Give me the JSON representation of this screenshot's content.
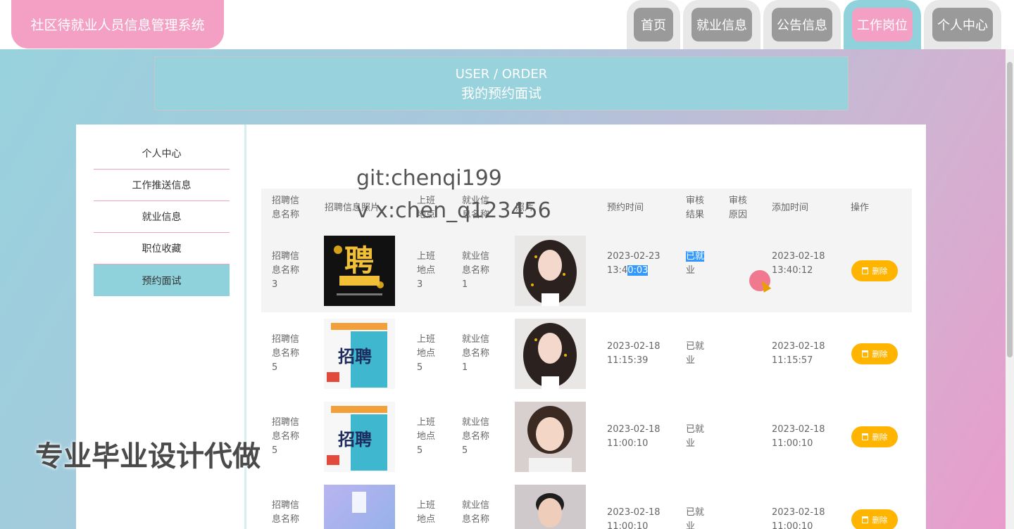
{
  "app": {
    "title": "社区待就业人员信息管理系统"
  },
  "nav": {
    "items": [
      "首页",
      "就业信息",
      "公告信息",
      "工作岗位",
      "个人中心"
    ],
    "active": "工作岗位"
  },
  "banner": {
    "en": "USER / ORDER",
    "zh": "我的预约面试"
  },
  "sidebar": {
    "items": [
      "个人中心",
      "工作推送信息",
      "就业信息",
      "职位收藏",
      "预约面试"
    ],
    "active": "预约面试"
  },
  "table": {
    "headers": [
      "招聘信\n息名称",
      "招聘信息照片",
      "上班\n地点",
      "就业信\n息名称",
      "照片",
      "预约时间",
      "审核\n结果",
      "审核\n原因",
      "添加时间",
      "操作"
    ],
    "rows": [
      {
        "name": "招聘信\n息名称\n3",
        "place": "上班\n地点\n3",
        "job": "就业信\n息名称\n1",
        "appt_date": "2023-02-23",
        "appt_time_a": "13:4",
        "appt_time_b": "0:03",
        "result_a": "已就",
        "result_b": "业",
        "reason": "",
        "added": "2023-02-18\n13:40:12",
        "action": "删除"
      },
      {
        "name": "招聘信\n息名称\n5",
        "place": "上班\n地点\n5",
        "job": "就业信\n息名称\n1",
        "appt": "2023-02-18\n11:15:39",
        "result": "已就\n业",
        "reason": "",
        "added": "2023-02-18\n11:15:57",
        "action": "删除"
      },
      {
        "name": "招聘信\n息名称\n5",
        "place": "上班\n地点\n5",
        "job": "就业信\n息名称\n5",
        "appt": "2023-02-18\n11:00:10",
        "result": "已就\n业",
        "reason": "",
        "added": "2023-02-18\n11:00:10",
        "action": "删除"
      },
      {
        "name": "招聘信\n息名称",
        "place": "上班\n地点",
        "job": "就业信\n息名称",
        "appt": "2023-02-18\n11:00:10",
        "result": "已就\n业",
        "reason": "",
        "added": "2023-02-18\n11:00:10",
        "action": "删除"
      }
    ]
  },
  "watermarks": {
    "git": "git:chenqi199",
    "vx": "v x:chen_q123456",
    "promo": "专业毕业设计代做"
  },
  "images": {
    "poster1_text": "聘",
    "poster2_text": "招聘"
  },
  "colors": {
    "pink": "#f3a0c4",
    "teal": "#8fd2dc",
    "delete": "#ffb400"
  }
}
